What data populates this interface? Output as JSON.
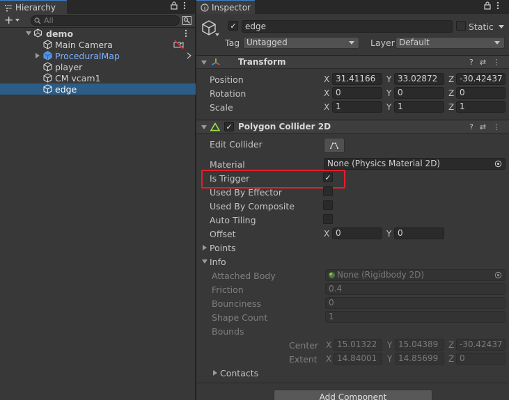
{
  "hierarchy": {
    "tab_label": "Hierarchy",
    "add_label": "+",
    "search_placeholder": "All",
    "scene": "demo",
    "items": [
      {
        "label": "Main Camera",
        "type": "object"
      },
      {
        "label": "ProceduralMap",
        "type": "prefab"
      },
      {
        "label": "player",
        "type": "object"
      },
      {
        "label": "CM vcam1",
        "type": "object"
      },
      {
        "label": "edge",
        "type": "object",
        "selected": true
      }
    ]
  },
  "inspector": {
    "tab_label": "Inspector",
    "object": {
      "name": "edge",
      "static_label": "Static",
      "tag_label": "Tag",
      "tag_value": "Untagged",
      "layer_label": "Layer",
      "layer_value": "Default"
    },
    "transform": {
      "title": "Transform",
      "rows": [
        {
          "label": "Position",
          "x": "31.41166",
          "y": "33.02872",
          "z": "-30.42437"
        },
        {
          "label": "Rotation",
          "x": "0",
          "y": "0",
          "z": "0"
        },
        {
          "label": "Scale",
          "x": "1",
          "y": "1",
          "z": "1"
        }
      ]
    },
    "collider": {
      "title": "Polygon Collider 2D",
      "edit_collider_label": "Edit Collider",
      "material_label": "Material",
      "material_value": "None (Physics Material 2D)",
      "is_trigger_label": "Is Trigger",
      "is_trigger": true,
      "used_by_effector_label": "Used By Effector",
      "used_by_composite_label": "Used By Composite",
      "auto_tiling_label": "Auto Tiling",
      "offset_label": "Offset",
      "offset_x": "0",
      "offset_y": "0",
      "points_label": "Points",
      "info_label": "Info",
      "attached_body_label": "Attached Body",
      "attached_body_value": "None (Rigidbody 2D)",
      "friction_label": "Friction",
      "friction_value": "0.4",
      "bounciness_label": "Bounciness",
      "bounciness_value": "0",
      "shape_count_label": "Shape Count",
      "shape_count_value": "1",
      "bounds_label": "Bounds",
      "center_label": "Center",
      "center_x": "15.01322",
      "center_y": "15.04389",
      "center_z": "-30.42437",
      "extent_label": "Extent",
      "extent_x": "14.84001",
      "extent_y": "14.85699",
      "extent_z": "0",
      "contacts_label": "Contacts"
    },
    "add_component_label": "Add Component",
    "axis_x": "X",
    "axis_y": "Y",
    "axis_z": "Z"
  },
  "colors": {
    "selection": "#2c5d87",
    "prefab_text": "#7cb1ff",
    "highlight": "#e0212b",
    "panel_bg": "#383838"
  }
}
